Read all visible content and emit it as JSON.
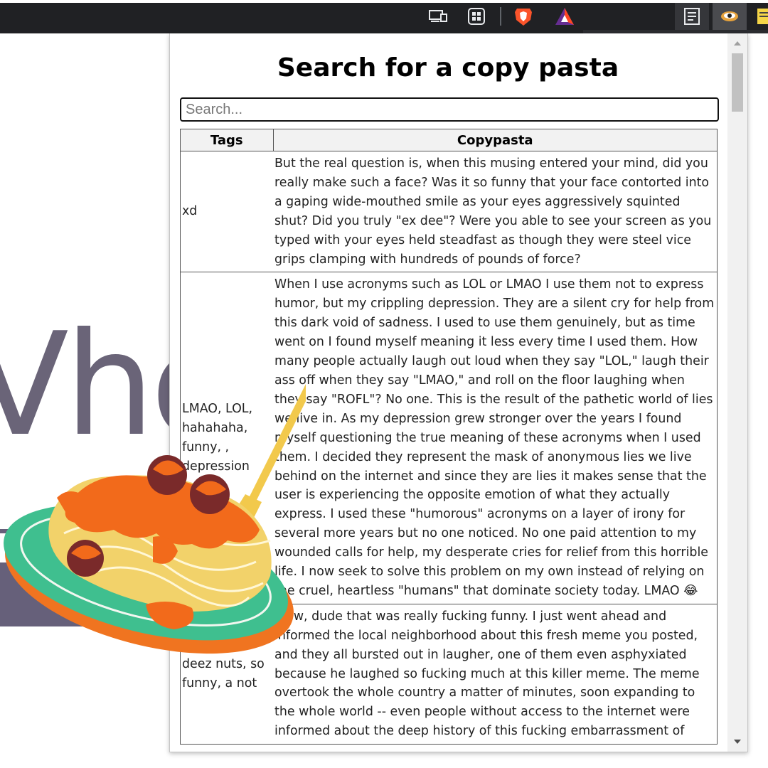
{
  "toolbar": {
    "icons": [
      "cast-icon",
      "extensions-grid-icon",
      "brave-shields-icon",
      "brave-rewards-icon",
      "reader-mode-icon",
      "copypasta-extension-icon",
      "notes-icon"
    ]
  },
  "background_page": {
    "heading_fragment": "Vho"
  },
  "popup": {
    "title": "Search for a copy pasta",
    "search": {
      "placeholder": "Search...",
      "value": ""
    },
    "table": {
      "headers": {
        "tags": "Tags",
        "copypasta": "Copypasta"
      },
      "rows": [
        {
          "tags": "xd",
          "text": "But the real question is, when this musing entered your mind, did you really make such a face? Was it so funny that your face contorted into a gaping wide-mouthed smile as your eyes aggressively squinted shut? Did you truly \"ex dee\"? Were you able to see your screen as you typed with your eyes held steadfast as though they were steel vice grips clamping with hundreds of pounds of force?"
        },
        {
          "tags": "LMAO, LOL, hahahaha, funny, , depression",
          "text": "When I use acronyms such as LOL or LMAO I use them not to express humor, but my crippling depression. They are a silent cry for help from this dark void of sadness. I used to use them genuinely, but as time went on I found myself meaning it less every time I used them. How many people actually laugh out loud when they say \"LOL,\" laugh their ass off when they say \"LMAO,\" and roll on the floor laughing when they say \"ROFL\"? No one. This is the result of the pathetic world of lies we live in. As my depression grew stronger over the years I found myself questioning the true meaning of these acronyms when I used them. I decided they represent the mask of anonymous lies we live behind on the internet and since they are lies it makes sense that the user is experiencing the opposite emotion of what they actually express. I used these \"humorous\" acronyms on a layer of irony for several more years but no one noticed. No one paid attention to my wounded calls for help, my desperate cries for relief from this horrible life. I now seek to solve this problem on my own instead of relying on the cruel, heartless \"humans\" that dominate society today. LMAO 😂"
        },
        {
          "tags": "deez nuts, so funny, a not",
          "text": "Wow, dude that was really fucking funny. I just went ahead and informed the local neighborhood about this fresh meme you posted, and they all bursted out in laugher, one of them even asphyxiated because he laughed so fucking much at this killer meme. The meme overtook the whole country a matter of minutes, soon expanding to the whole world -- even people without access to the internet were informed about the deep history of this fucking embarrassment of"
        }
      ]
    }
  },
  "colors": {
    "toolbar_bg": "#202124",
    "plate_green": "#3fbf8f",
    "plate_rim": "#f07420",
    "sauce": "#f26a1b",
    "noodles": "#f2d26a",
    "meatball": "#7a2a2a",
    "fork": "#f2c94c"
  }
}
